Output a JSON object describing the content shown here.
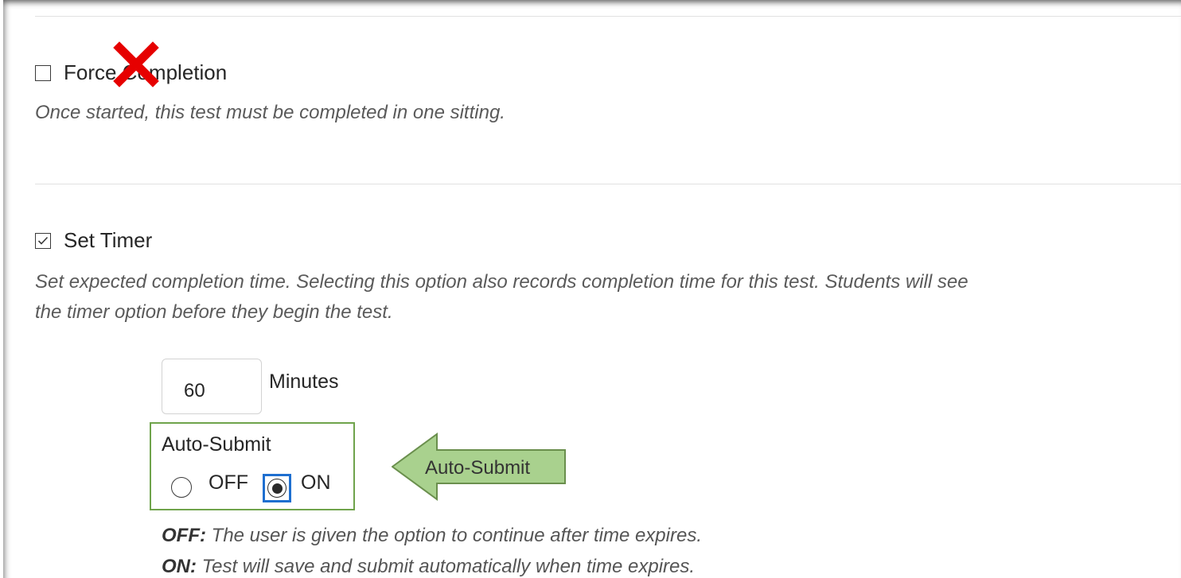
{
  "force_completion": {
    "label": "Force Completion",
    "checked": false,
    "description": "Once started, this test must be completed in one sitting."
  },
  "set_timer": {
    "label": "Set Timer",
    "checked": true,
    "description_line1": "Set expected completion time. Selecting this option also records completion time for this test. Students will see",
    "description_line2": "the timer option before they begin the test.",
    "minutes_value": "60",
    "minutes_label": "Minutes"
  },
  "auto_submit": {
    "title": "Auto-Submit",
    "off_label": "OFF",
    "on_label": "ON",
    "selected": "ON",
    "callout_label": "Auto-Submit",
    "off_key": "OFF:",
    "off_text": " The user is given the option to continue after time expires.",
    "on_key": "ON:",
    "on_text": " Test will save and submit automatically when time expires."
  },
  "colors": {
    "callout_fill": "#a9d18e",
    "callout_border": "#6fa34b",
    "red_mark": "#e60000",
    "focus_ring": "#1e6fd0"
  },
  "icons": [
    "checkbox-empty-icon",
    "checkbox-checked-icon",
    "red-x-icon",
    "arrow-left-icon"
  ]
}
